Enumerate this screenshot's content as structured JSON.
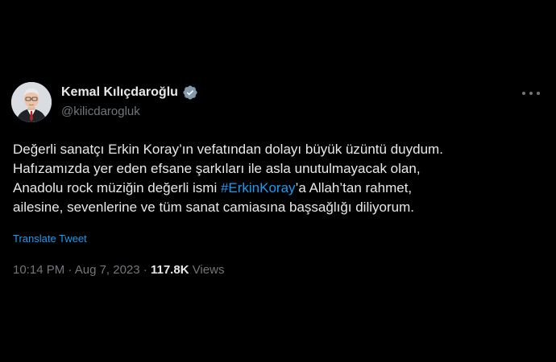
{
  "author": {
    "display_name": "Kemal Kılıçdaroğlu",
    "handle": "@kilicdarogluk",
    "verified_icon": "verified-badge-icon",
    "avatar_icon": "profile-photo"
  },
  "menu": {
    "icon": "more-horizontal-icon"
  },
  "tweet": {
    "lines": {
      "l1": "Değerli sanatçı Erkin Koray’ın vefatından dolayı büyük üzüntü duydum.",
      "l2": "Hafızamızda yer eden efsane şarkıları ile asla unutulmayacak olan,",
      "l3_before": "Anadolu rock müziğin değerli ismi ",
      "l3_hashtag": "#ErkinKoray",
      "l3_after": "’a Allah’tan rahmet,",
      "l4": "ailesine, sevenlerine ve tüm sanat camiasına başsağlığı diliyorum."
    },
    "translate_label": "Translate Tweet"
  },
  "meta": {
    "time": "10:14 PM",
    "separator": "·",
    "date": "Aug 7, 2023",
    "views_count": "117.8K",
    "views_label": "Views"
  },
  "colors": {
    "background": "#000000",
    "text": "#e7e9ea",
    "secondary": "#71767b",
    "link": "#1d9bf0"
  }
}
